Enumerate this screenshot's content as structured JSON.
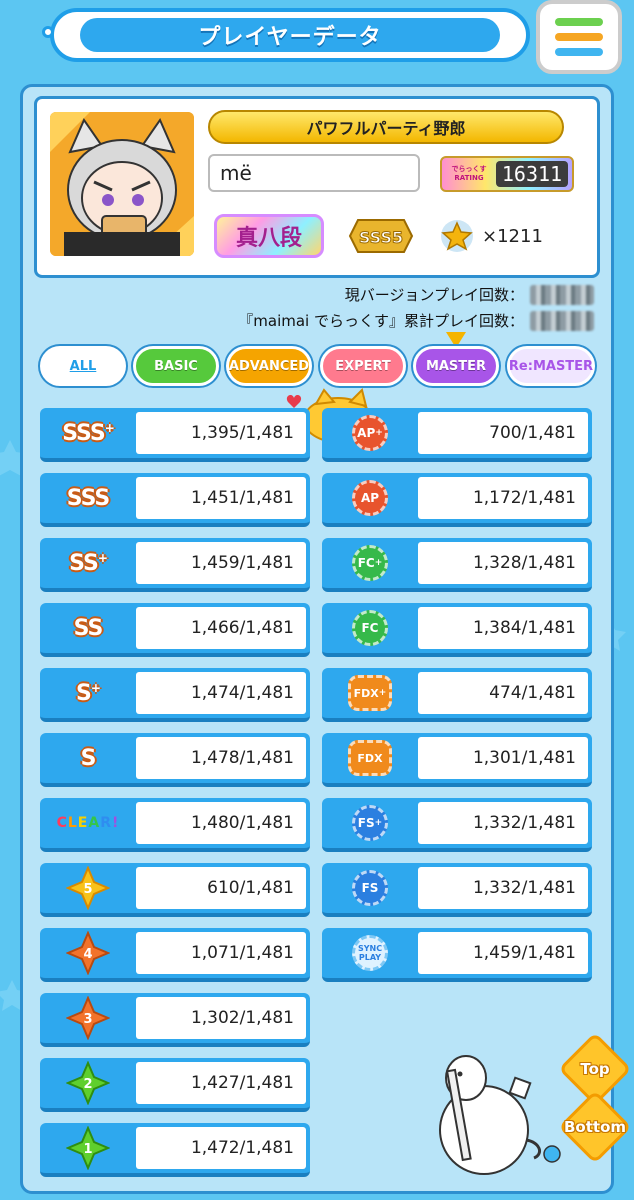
{
  "header": {
    "title": "プレイヤーデータ"
  },
  "profile": {
    "title_badge": "パワフルパーティ野郎",
    "player_name": "më",
    "rating_label": "でらっくす RATING",
    "rating": "16311",
    "dan": "真八段",
    "class_rank": "SSS5",
    "stars": "×1211"
  },
  "playcounts": {
    "version_label": "現バージョンプレイ回数：",
    "total_label": "『maimai でらっくす』累計プレイ回数："
  },
  "tabs": [
    {
      "label": "ALL",
      "active": true
    },
    {
      "label": "BASIC",
      "color": "#56c93c"
    },
    {
      "label": "ADVANCED",
      "color": "#f5a400"
    },
    {
      "label": "EXPERT",
      "color": "#ff7a8e"
    },
    {
      "label": "MASTER",
      "color": "#a855e8"
    },
    {
      "label": "Re:MASTER",
      "color": "#f0e6ff"
    }
  ],
  "rank_stats": [
    {
      "icon": "sss-plus",
      "label": "SSS+",
      "value": "1,395/1,481"
    },
    {
      "icon": "sss",
      "label": "SSS",
      "value": "1,451/1,481"
    },
    {
      "icon": "ss-plus",
      "label": "SS+",
      "value": "1,459/1,481"
    },
    {
      "icon": "ss",
      "label": "SS",
      "value": "1,466/1,481"
    },
    {
      "icon": "s-plus",
      "label": "S+",
      "value": "1,474/1,481"
    },
    {
      "icon": "s",
      "label": "S",
      "value": "1,478/1,481"
    },
    {
      "icon": "clear",
      "label": "CLEAR!",
      "value": "1,480/1,481"
    },
    {
      "icon": "star-5",
      "label": "5",
      "value": "610/1,481"
    },
    {
      "icon": "star-4",
      "label": "4",
      "value": "1,071/1,481"
    },
    {
      "icon": "star-3",
      "label": "3",
      "value": "1,302/1,481"
    },
    {
      "icon": "star-2",
      "label": "2",
      "value": "1,427/1,481"
    },
    {
      "icon": "star-1",
      "label": "1",
      "value": "1,472/1,481"
    }
  ],
  "combo_stats": [
    {
      "icon": "ap-plus",
      "label": "AP+",
      "value": "700/1,481"
    },
    {
      "icon": "ap",
      "label": "AP",
      "value": "1,172/1,481"
    },
    {
      "icon": "fc-plus",
      "label": "FC+",
      "value": "1,328/1,481"
    },
    {
      "icon": "fc",
      "label": "FC",
      "value": "1,384/1,481"
    },
    {
      "icon": "fdx-plus",
      "label": "FDX+",
      "value": "474/1,481"
    },
    {
      "icon": "fdx",
      "label": "FDX",
      "value": "1,301/1,481"
    },
    {
      "icon": "fs-plus",
      "label": "FS+",
      "value": "1,332/1,481"
    },
    {
      "icon": "fs",
      "label": "FS",
      "value": "1,332/1,481"
    },
    {
      "icon": "sync-play",
      "label": "SYNC PLAY",
      "value": "1,459/1,481"
    }
  ],
  "nav": {
    "top": "Top",
    "bottom": "Bottom"
  },
  "colors": {
    "background": "#5cc6f2",
    "panel": "#b8e4f8",
    "row": "#2ea8ee"
  }
}
